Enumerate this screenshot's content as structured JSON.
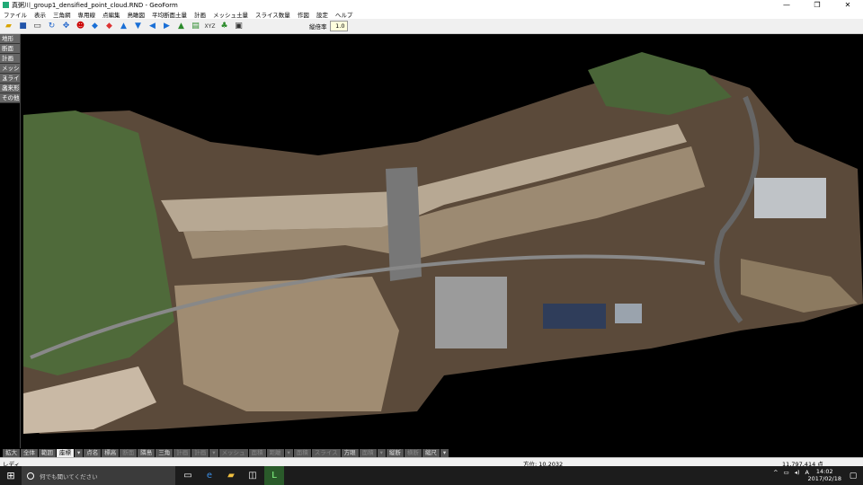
{
  "window": {
    "title": "真粥川_group1_densified_point_cloud.RND - GeoForm",
    "minimize": "—",
    "maximize": "❐",
    "close": "✕"
  },
  "menu": [
    "ファイル",
    "表示",
    "三角網",
    "専用線",
    "点編集",
    "鳥瞰図",
    "平均断面土量",
    "計画",
    "メッシュ土量",
    "スライス数量",
    "作図",
    "設定",
    "ヘルプ"
  ],
  "toolbar": {
    "icons": [
      "open-icon",
      "save-icon",
      "select-icon",
      "rotate-icon",
      "move-icon",
      "person-icon",
      "cube-blue-icon",
      "cube-red-icon",
      "arrow-up-icon",
      "arrow-down-icon",
      "arrow-left-icon",
      "arrow-right-icon",
      "terrain-icon",
      "section-icon",
      "xyz-icon",
      "tree-icon",
      "monitor-icon"
    ],
    "ratio_label": "縦倍率",
    "ratio_value": "1.0"
  },
  "left_panel": [
    "地形",
    "断面",
    "計画",
    "メッシュ",
    "スライス",
    "出来形",
    "その他"
  ],
  "bottom_bar": [
    {
      "label": "拡大",
      "state": "normal"
    },
    {
      "label": "全体",
      "state": "normal"
    },
    {
      "label": "範囲",
      "state": "normal"
    },
    {
      "label": "座標",
      "state": "selected"
    },
    {
      "label": "▾",
      "state": "normal"
    },
    {
      "label": "点名",
      "state": "normal"
    },
    {
      "label": "標高",
      "state": "normal"
    },
    {
      "label": "断面",
      "state": "dim"
    },
    {
      "label": "隣島",
      "state": "normal"
    },
    {
      "label": "三角",
      "state": "normal"
    },
    {
      "label": "計画",
      "state": "dim"
    },
    {
      "label": "計画",
      "state": "dim"
    },
    {
      "label": "▾",
      "state": "dim"
    },
    {
      "label": "メッシュ",
      "state": "dim"
    },
    {
      "label": "面積",
      "state": "dim"
    },
    {
      "label": "距離",
      "state": "dim"
    },
    {
      "label": "▾",
      "state": "dim"
    },
    {
      "label": "面積",
      "state": "dim"
    },
    {
      "label": "スライス",
      "state": "dim"
    },
    {
      "label": "方眼",
      "state": "normal"
    },
    {
      "label": "面積",
      "state": "dim"
    },
    {
      "label": "▾",
      "state": "dim"
    },
    {
      "label": "縦断",
      "state": "normal"
    },
    {
      "label": "横断",
      "state": "dim"
    },
    {
      "label": "縮尺",
      "state": "normal"
    },
    {
      "label": "▾",
      "state": "normal"
    }
  ],
  "status": {
    "ready": "レディ",
    "angle": "方位: 10.2032",
    "points": "11,797,414 点"
  },
  "taskbar": {
    "search_placeholder": "何でも聞いてください",
    "time": "14:02",
    "date": "2017/02/18",
    "ime": "A"
  }
}
